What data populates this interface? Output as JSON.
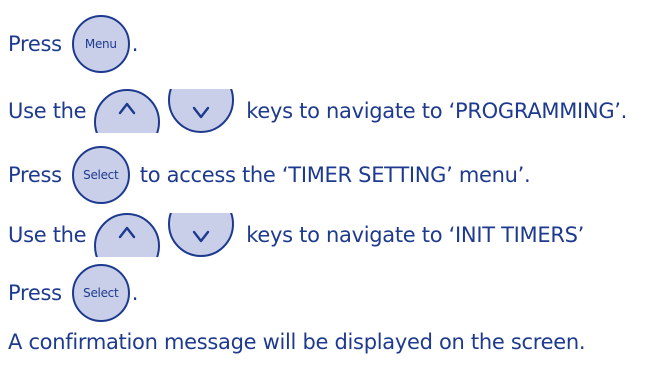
{
  "steps": [
    {
      "prefix": "Press",
      "key": "Menu",
      "suffix": "."
    },
    {
      "prefix": "Use the",
      "suffix": "keys to navigate to ‘PROGRAMMING’."
    },
    {
      "prefix": "Press",
      "key": "Select",
      "suffix": "to access the ‘TIMER SETTING’ menu’."
    },
    {
      "prefix": "Use the",
      "suffix": "keys to navigate to ‘INIT TIMERS’"
    },
    {
      "prefix": "Press",
      "key": "Select",
      "suffix": "."
    }
  ],
  "confirmation": "A confirmation message will be displayed on the screen.",
  "icons": {
    "up": "chevron-up-icon",
    "down": "chevron-down-icon"
  },
  "colors": {
    "text": "#1e3a8f",
    "key_fill": "#c9cfe8",
    "key_border": "#1e3a8f"
  }
}
